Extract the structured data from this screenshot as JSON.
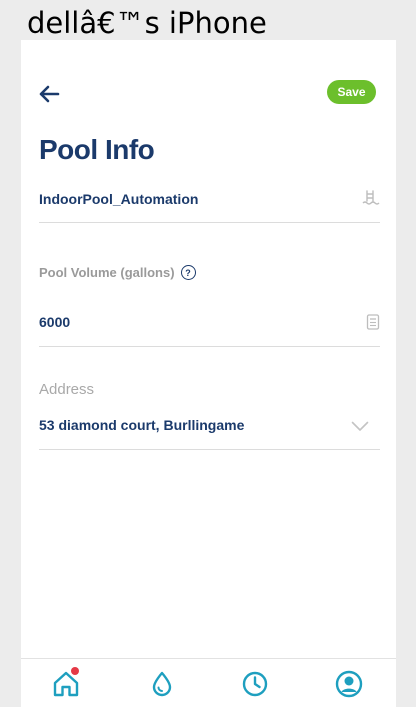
{
  "window": {
    "title": "dellâ€™s iPhone"
  },
  "header": {
    "save_label": "Save"
  },
  "page": {
    "title": "Pool Info"
  },
  "fields": {
    "pool_name": {
      "value": "IndoorPool_Automation"
    },
    "pool_volume": {
      "label": "Pool Volume (gallons)",
      "help_symbol": "?",
      "value": "6000"
    },
    "address": {
      "label": "Address",
      "value": "53 diamond court, Burllingame"
    }
  },
  "tabs": [
    {
      "name": "home",
      "icon": "home-icon",
      "has_notification": true
    },
    {
      "name": "water",
      "icon": "water-drop-icon"
    },
    {
      "name": "history",
      "icon": "clock-icon"
    },
    {
      "name": "profile",
      "icon": "user-icon"
    }
  ],
  "colors": {
    "primary_text": "#1b3a6b",
    "accent_teal": "#1e9fbf",
    "save_green": "#6cbf2c",
    "notification_red": "#e53946"
  }
}
